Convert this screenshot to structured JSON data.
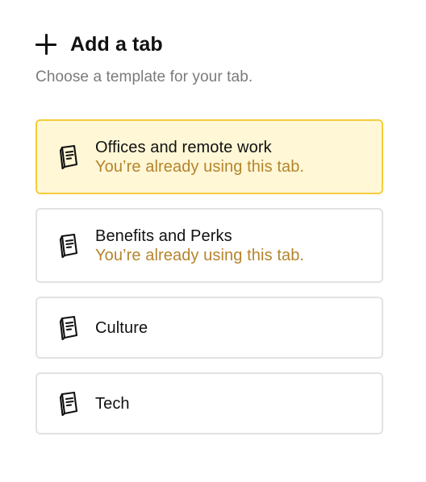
{
  "header": {
    "title": "Add a tab",
    "subtitle": "Choose a template for your tab."
  },
  "templates": [
    {
      "name": "Offices and remote work",
      "note": "You’re already using this tab.",
      "selected": true
    },
    {
      "name": "Benefits and Perks",
      "note": "You’re already using this tab.",
      "selected": false
    },
    {
      "name": "Culture",
      "note": "",
      "selected": false
    },
    {
      "name": "Tech",
      "note": "",
      "selected": false
    }
  ],
  "colors": {
    "selected_background": "#fff7d6",
    "selected_border": "#f5cd3a",
    "note_text": "#b5842c",
    "subtitle_text": "#7a7a7a"
  },
  "icons": {
    "add": "plus-icon",
    "template": "notebook-icon"
  }
}
